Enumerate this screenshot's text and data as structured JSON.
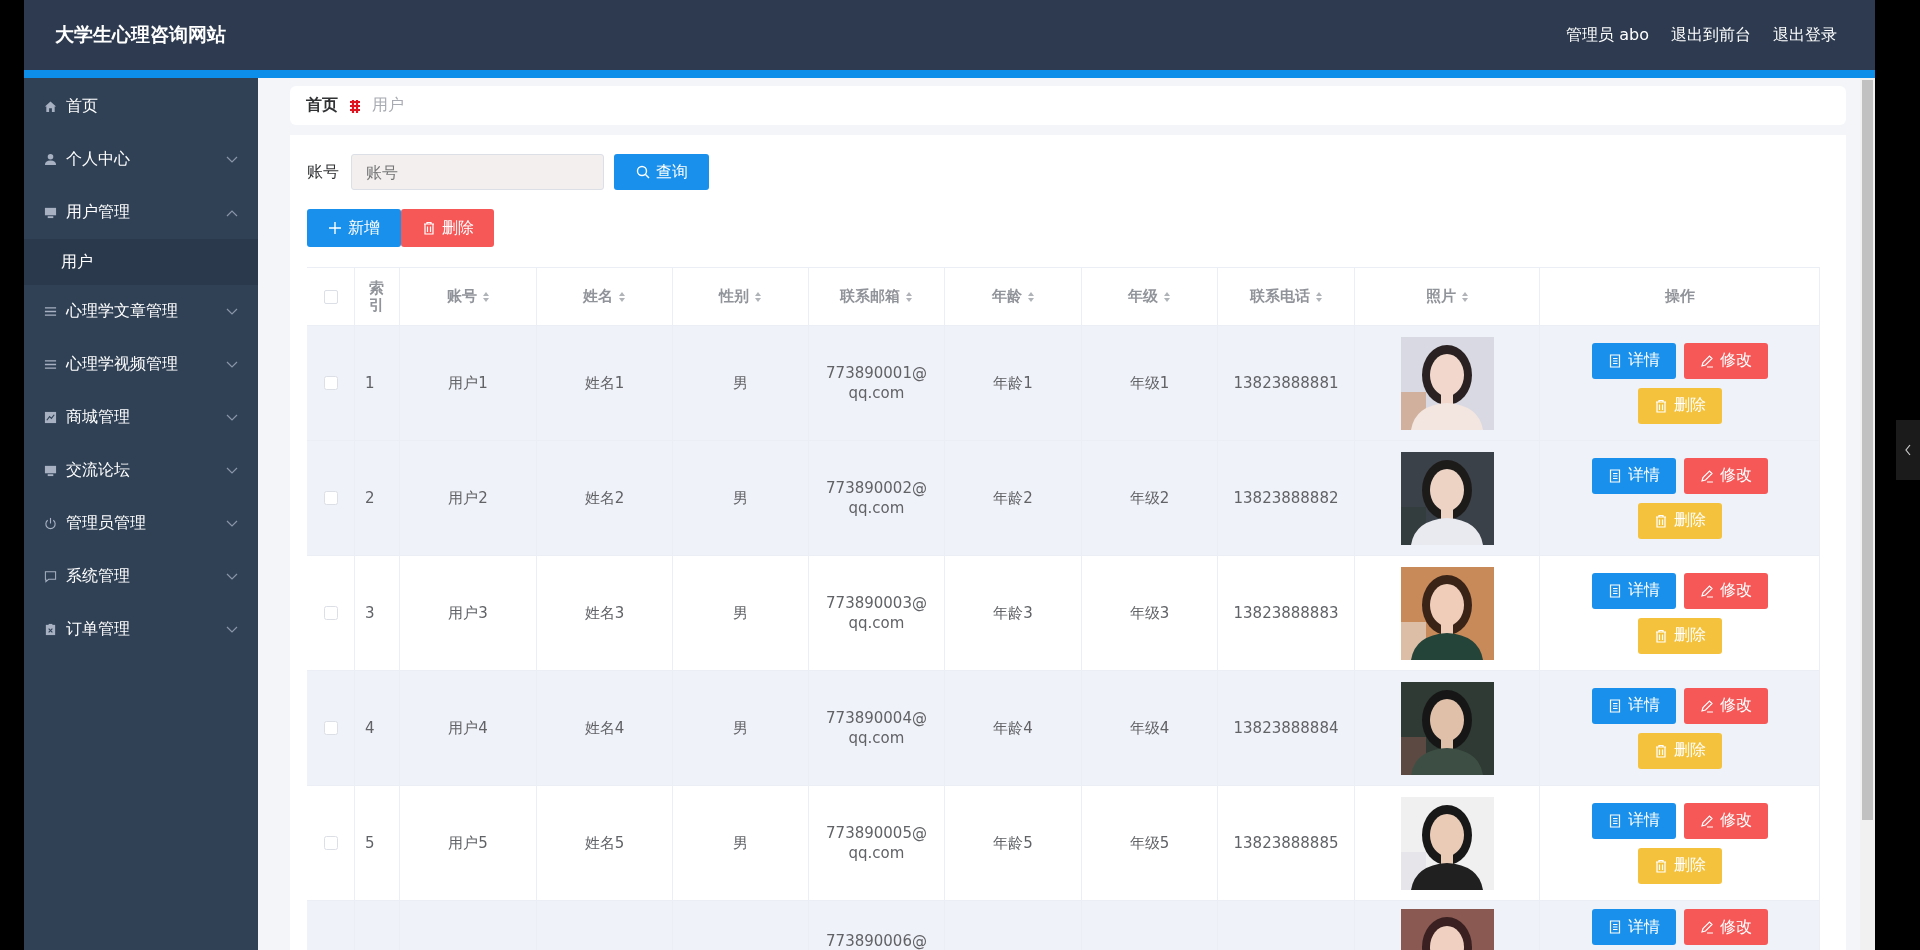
{
  "header": {
    "title": "大学生心理咨询网站",
    "user": "管理员 abo",
    "links": [
      "退出到前台",
      "退出登录"
    ]
  },
  "sidebar": {
    "items": [
      {
        "label": "首页",
        "kind": "link"
      },
      {
        "label": "个人中心",
        "kind": "submenu",
        "expanded": false
      },
      {
        "label": "用户管理",
        "kind": "submenu",
        "expanded": true,
        "children": [
          {
            "label": "用户",
            "selected": true
          }
        ]
      },
      {
        "label": "心理学文章管理",
        "kind": "submenu",
        "expanded": false
      },
      {
        "label": "心理学视频管理",
        "kind": "submenu",
        "expanded": false
      },
      {
        "label": "商城管理",
        "kind": "submenu",
        "expanded": false
      },
      {
        "label": "交流论坛",
        "kind": "submenu",
        "expanded": false
      },
      {
        "label": "管理员管理",
        "kind": "submenu",
        "expanded": false
      },
      {
        "label": "系统管理",
        "kind": "submenu",
        "expanded": false
      },
      {
        "label": "订单管理",
        "kind": "submenu",
        "expanded": false
      }
    ]
  },
  "breadcrumb": [
    "首页",
    "用户"
  ],
  "search": {
    "label": "账号",
    "placeholder": "账号",
    "button": "查询"
  },
  "actions": [
    "新增",
    "删除"
  ],
  "table": {
    "select_all": false,
    "columns": [
      {
        "label": "索引",
        "sortable": false
      },
      {
        "label": "账号",
        "sortable": true
      },
      {
        "label": "姓名",
        "sortable": true
      },
      {
        "label": "性别",
        "sortable": true
      },
      {
        "label": "联系邮箱",
        "sortable": true
      },
      {
        "label": "年龄",
        "sortable": true
      },
      {
        "label": "年级",
        "sortable": true
      },
      {
        "label": "联系电话",
        "sortable": true
      },
      {
        "label": "照片",
        "sortable": true
      },
      {
        "label": "操作",
        "sortable": false
      }
    ],
    "rows": [
      {
        "checked": false,
        "highlighted": true,
        "cells": [
          "1",
          "用户1",
          "姓名1",
          "男",
          "773890001@qq.com",
          "年龄1",
          "年级1",
          "13823888881"
        ],
        "photo": {
          "kind": "picture"
        },
        "actions": [
          "详情",
          "修改",
          "删除"
        ]
      },
      {
        "checked": false,
        "highlighted": true,
        "cells": [
          "2",
          "用户2",
          "姓名2",
          "男",
          "773890002@qq.com",
          "年龄2",
          "年级2",
          "13823888882"
        ],
        "photo": {
          "kind": "picture"
        },
        "actions": [
          "详情",
          "修改",
          "删除"
        ]
      },
      {
        "checked": false,
        "highlighted": false,
        "cells": [
          "3",
          "用户3",
          "姓名3",
          "男",
          "773890003@qq.com",
          "年龄3",
          "年级3",
          "13823888883"
        ],
        "photo": {
          "kind": "picture"
        },
        "actions": [
          "详情",
          "修改",
          "删除"
        ]
      },
      {
        "checked": false,
        "highlighted": true,
        "cells": [
          "4",
          "用户4",
          "姓名4",
          "男",
          "773890004@qq.com",
          "年龄4",
          "年级4",
          "13823888884"
        ],
        "photo": {
          "kind": "picture"
        },
        "actions": [
          "详情",
          "修改",
          "删除"
        ]
      },
      {
        "checked": false,
        "highlighted": false,
        "cells": [
          "5",
          "用户5",
          "姓名5",
          "男",
          "773890005@qq.com",
          "年龄5",
          "年级5",
          "13823888885"
        ],
        "photo": {
          "kind": "picture"
        },
        "actions": [
          "详情",
          "修改",
          "删除"
        ]
      },
      {
        "highlighted": true,
        "cells": [
          "",
          "",
          "",
          "",
          "773890006@",
          "",
          "",
          ""
        ],
        "photo": {
          "kind": "picture"
        },
        "actions": [
          "详情",
          "修改"
        ]
      }
    ]
  }
}
